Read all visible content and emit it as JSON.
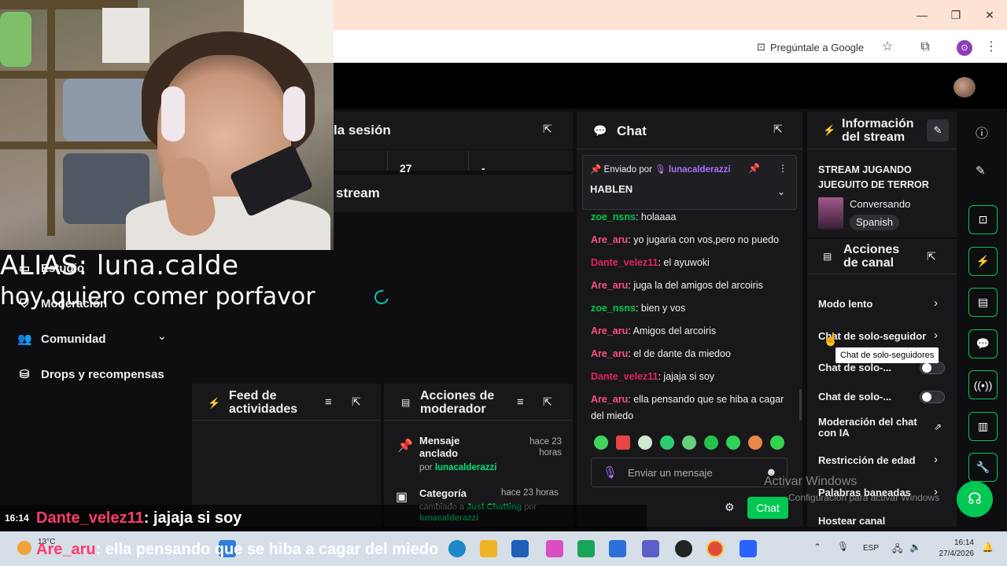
{
  "browser": {
    "ask_google": "Pregúntale a Google",
    "win_min": "—",
    "win_max": "❐",
    "win_close": "✕"
  },
  "overlay": {
    "alias": "ALIAS: luna.calde",
    "message": "hoy quiero comer porfavor"
  },
  "left_nav": {
    "items": [
      {
        "label": "Estudio",
        "icon": "studio-icon"
      },
      {
        "label": "Moderación",
        "icon": "moderation-icon"
      },
      {
        "label": "Comunidad",
        "icon": "community-icon"
      },
      {
        "label": "Drops y recompensas",
        "icon": "drops-icon"
      }
    ]
  },
  "session_panel": {
    "title": "la sesión",
    "stat_value": "27",
    "stat_dash": "-"
  },
  "stream_panel": {
    "title": "stream"
  },
  "activity_feed": {
    "title_line1": "Feed de",
    "title_line2": "actividades"
  },
  "mod_actions": {
    "title_line1": "Acciones de",
    "title_line2": "moderador",
    "items": [
      {
        "title_line1": "Mensaje",
        "title_line2": "anclado",
        "time_line1": "hace 23",
        "time_line2": "horas",
        "by_prefix": "por",
        "by_user": "lunacalderazzi",
        "icon": "pin-icon"
      },
      {
        "title_line1": "Categoría",
        "title_line2": "",
        "time_line1": "hace 23 horas",
        "time_line2": "",
        "changed_prefix": "cambiado a",
        "changed_value": "Just Chatting",
        "changed_by": "por",
        "by_user": "lunacalderazzi",
        "icon": "category-icon"
      }
    ]
  },
  "chat": {
    "title": "Chat",
    "pinned": {
      "sent_by": "Enviado por",
      "user": "lunacalderazzi",
      "message": "HABLEN"
    },
    "messages": [
      {
        "user": "zoe_nsns",
        "text": ": holaaaa",
        "color": "#00c853"
      },
      {
        "user": "Are_aru",
        "text": ": yo jugaria con vos,pero no puedo",
        "color": "#ff4f7b"
      },
      {
        "user": "Dante_velez11",
        "text": ": el ayuwoki",
        "color": "#e0245e"
      },
      {
        "user": "Are_aru",
        "text": ": juga la del amigos del arcoiris",
        "color": "#ff4f7b"
      },
      {
        "user": "zoe_nsns",
        "text": ": bien y vos",
        "color": "#00c853"
      },
      {
        "user": "Are_aru",
        "text": ": Amigos del arcoiris",
        "color": "#ff4f7b"
      },
      {
        "user": "Are_aru",
        "text": ": el de dante da miedoo",
        "color": "#ff4f7b"
      },
      {
        "user": "Dante_velez11",
        "text": ": jajaja si soy",
        "color": "#e0245e"
      },
      {
        "user": "Are_aru",
        "text": ": ella pensando que se hiba a cagar del miedo",
        "color": "#ff4f7b"
      }
    ],
    "input_placeholder": "Enviar un mensaje",
    "send_label": "Chat"
  },
  "stream_info": {
    "title_line1": "Información",
    "title_line2": "del stream",
    "stream_title_line1": "STREAM JUGANDO",
    "stream_title_line2": "JUEGUITO DE TERROR",
    "category": "Conversando",
    "language": "Spanish"
  },
  "channel_actions": {
    "title_line1": "Acciones",
    "title_line2": "de canal",
    "items": [
      {
        "label": "Modo lento",
        "kind": "arrow"
      },
      {
        "label": "Chat de solo-seguidor",
        "kind": "arrow"
      },
      {
        "label": "Chat de solo-...",
        "kind": "toggle"
      },
      {
        "label": "Chat de solo-...",
        "kind": "toggle"
      },
      {
        "label_line1": "Moderación del chat",
        "label_line2": "con IA",
        "kind": "external"
      },
      {
        "label": "Restricción de edad",
        "kind": "arrow"
      },
      {
        "label": "Palabras baneadas",
        "kind": "arrow"
      },
      {
        "label": "Hostear canal",
        "kind": "none"
      }
    ],
    "tooltip": "Chat de solo-seguidores"
  },
  "watermark": {
    "line1": "Activar Windows",
    "line2": "Configuración para activar Windows"
  },
  "bottom_overlay": {
    "time": "16:14",
    "line1_user": "Dante_velez11",
    "line1_text": ": jajaja si soy",
    "line2_user": "Are_aru",
    "line2_text": ": ella pensando que se hiba a cagar del miedo"
  },
  "taskbar": {
    "lang": "ESP",
    "time": "16:14",
    "date": "27/4/2026",
    "weather": "13°C"
  }
}
